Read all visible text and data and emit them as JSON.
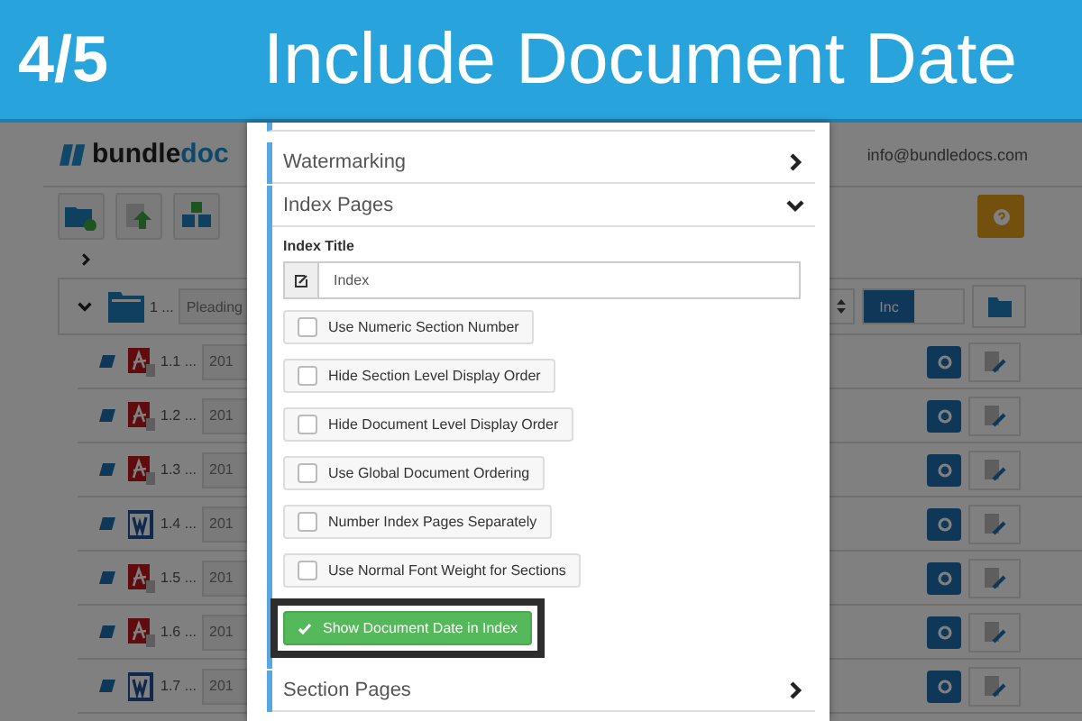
{
  "banner": {
    "step": "4/5",
    "title": "Include Document Date"
  },
  "app": {
    "logo": {
      "part_1": "bundle",
      "part_2": "doc"
    },
    "user_email": "info@bundledocs.com",
    "folder_row": {
      "number": "1 ...",
      "name": "Pleading",
      "toggle": "Inc"
    },
    "documents": [
      {
        "number": "1.1 ...",
        "date": "201",
        "kind": "pdf"
      },
      {
        "number": "1.2 ...",
        "date": "201",
        "kind": "pdf"
      },
      {
        "number": "1.3 ...",
        "date": "201",
        "kind": "pdf"
      },
      {
        "number": "1.4 ...",
        "date": "201",
        "kind": "word"
      },
      {
        "number": "1.5 ...",
        "date": "201",
        "kind": "pdf"
      },
      {
        "number": "1.6 ...",
        "date": "201",
        "kind": "pdf"
      },
      {
        "number": "1.7 ...",
        "date": "201",
        "kind": "word"
      }
    ]
  },
  "dialog": {
    "sections": [
      {
        "title": "Watermarking",
        "expanded": false
      },
      {
        "title": "Index Pages",
        "expanded": true,
        "content": {
          "index_title": {
            "label": "Index Title",
            "value": "Index"
          },
          "options": [
            {
              "label": "Use Numeric Section Number",
              "checked": false
            },
            {
              "label": "Hide Section Level Display Order",
              "checked": false
            },
            {
              "label": "Hide Document Level Display Order",
              "checked": false
            },
            {
              "label": "Use Global Document Ordering",
              "checked": false
            },
            {
              "label": "Number Index Pages Separately",
              "checked": false
            },
            {
              "label": "Use Normal Font Weight for Sections",
              "checked": false
            },
            {
              "label": "Show Document Date in Index",
              "checked": true
            }
          ]
        }
      },
      {
        "title": "Section Pages",
        "expanded": false
      }
    ]
  }
}
